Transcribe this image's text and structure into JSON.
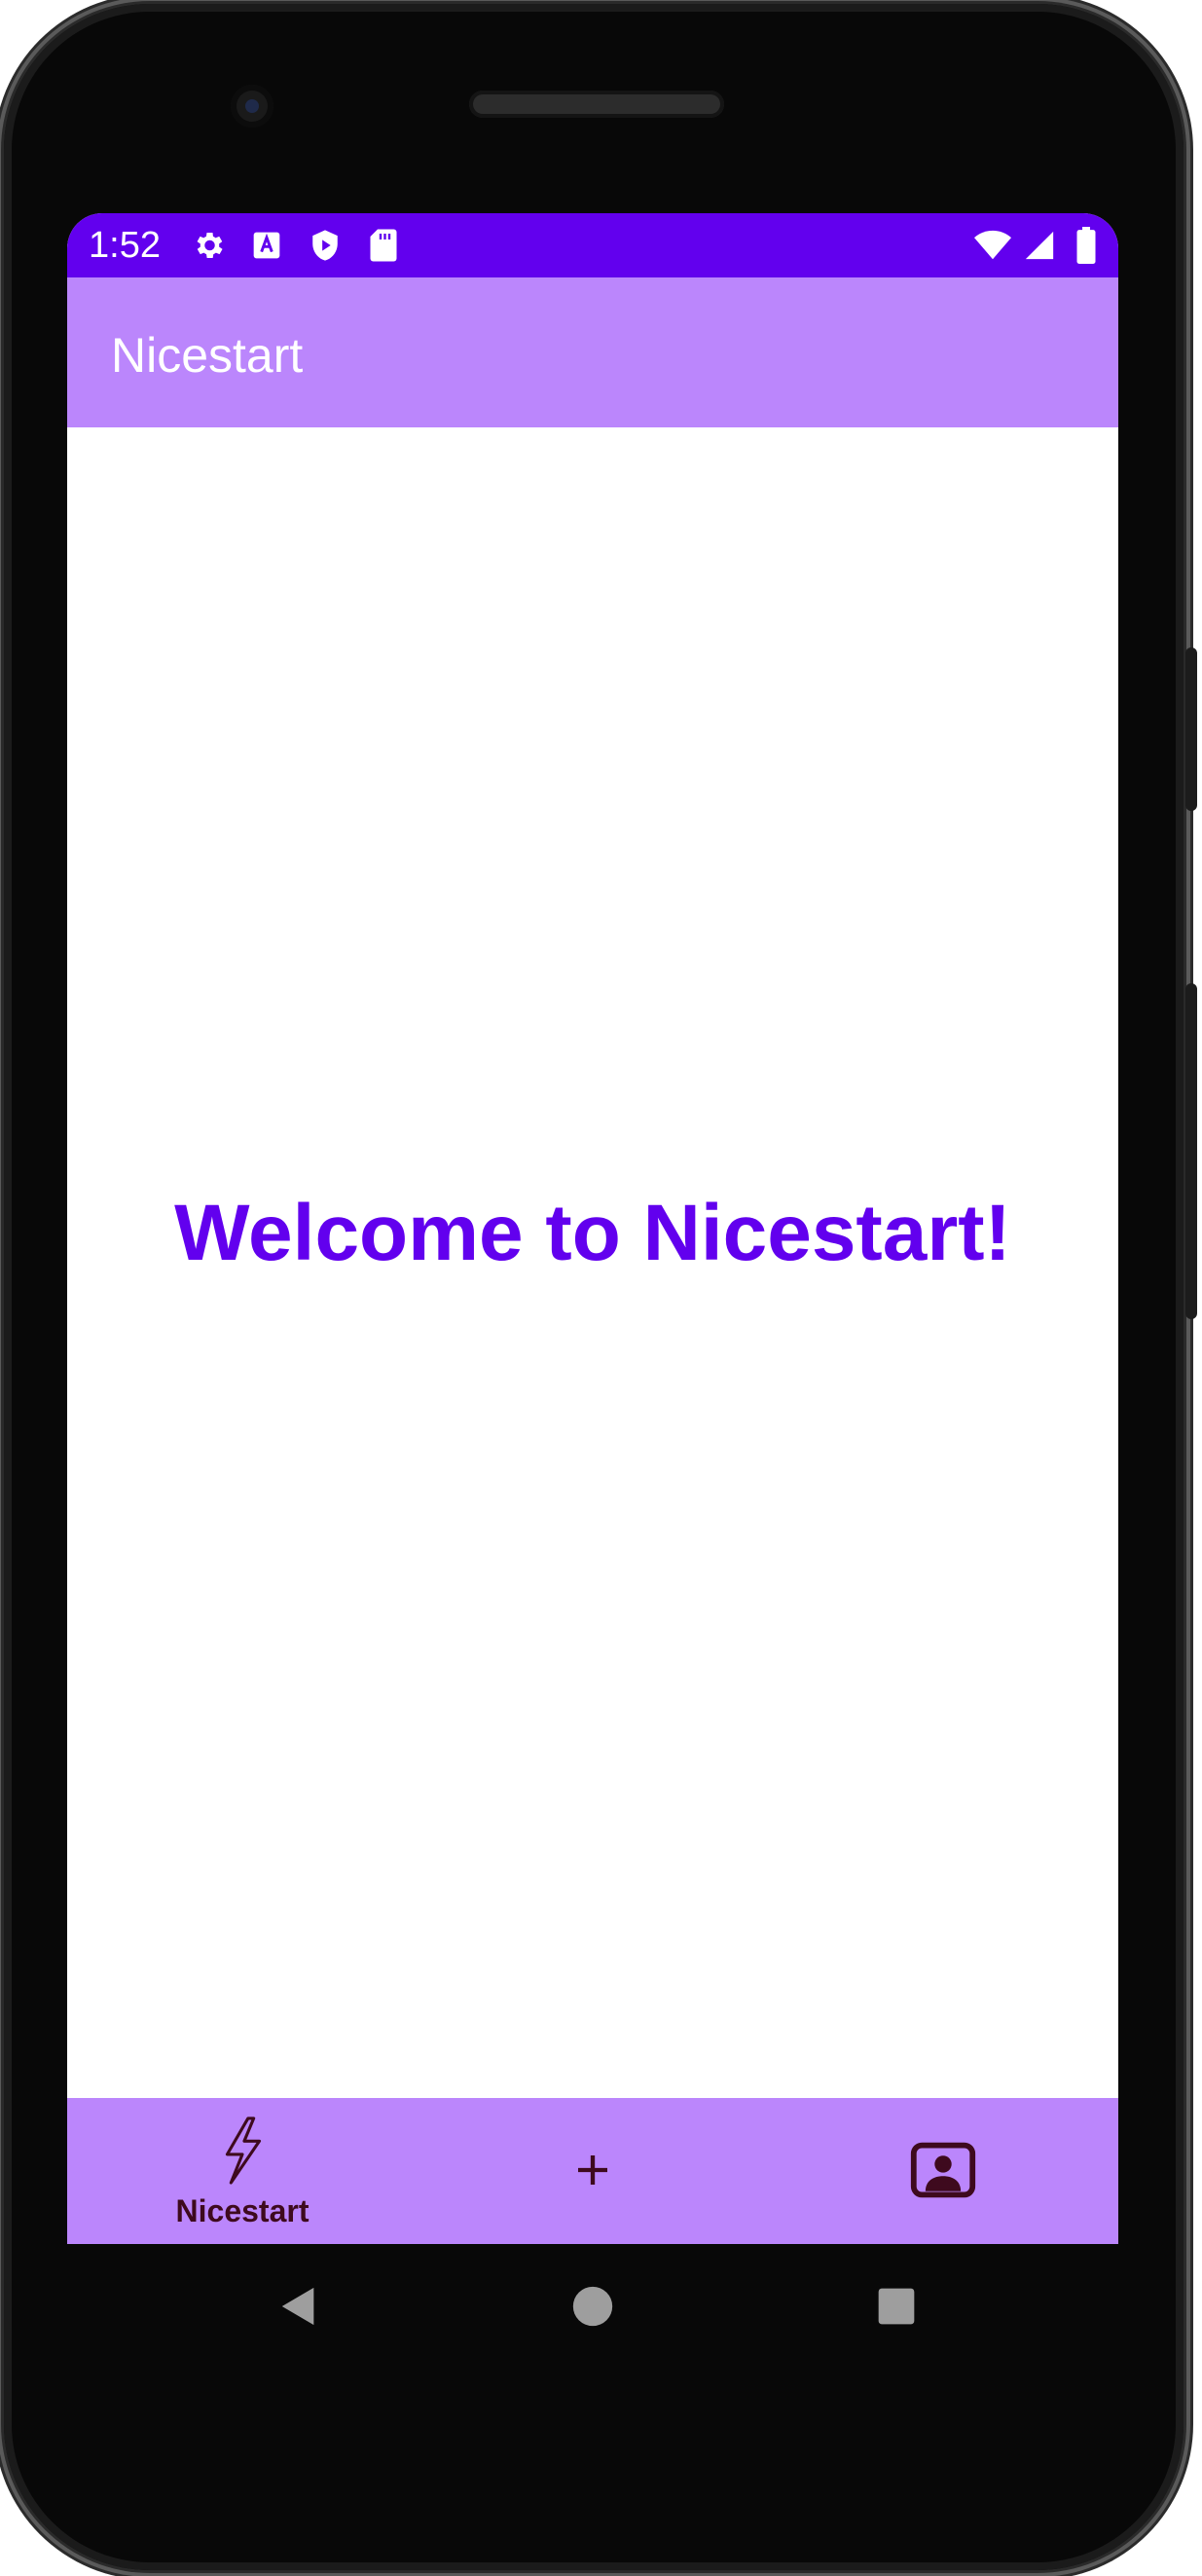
{
  "status_bar": {
    "time": "1:52",
    "left_icons": [
      "settings-icon",
      "keyboard-a-icon",
      "play-protect-icon",
      "sd-card-icon"
    ],
    "right_icons": [
      "wifi-icon",
      "cell-signal-icon",
      "battery-icon"
    ],
    "background": "#6200ee"
  },
  "app_bar": {
    "title": "Nicestart",
    "background": "#bb86fc"
  },
  "main": {
    "welcome_text": "Welcome to Nicestart!",
    "welcome_color": "#6200ee"
  },
  "bottom_nav": {
    "background": "#bb86fc",
    "items": [
      {
        "icon": "lightning-bolt-icon",
        "label": "Nicestart",
        "selected": true
      },
      {
        "icon": "plus-icon",
        "label": "",
        "selected": false
      },
      {
        "icon": "profile-card-icon",
        "label": "",
        "selected": false
      }
    ]
  },
  "system_nav": {
    "buttons": [
      "back-icon",
      "home-icon",
      "recents-icon"
    ]
  }
}
